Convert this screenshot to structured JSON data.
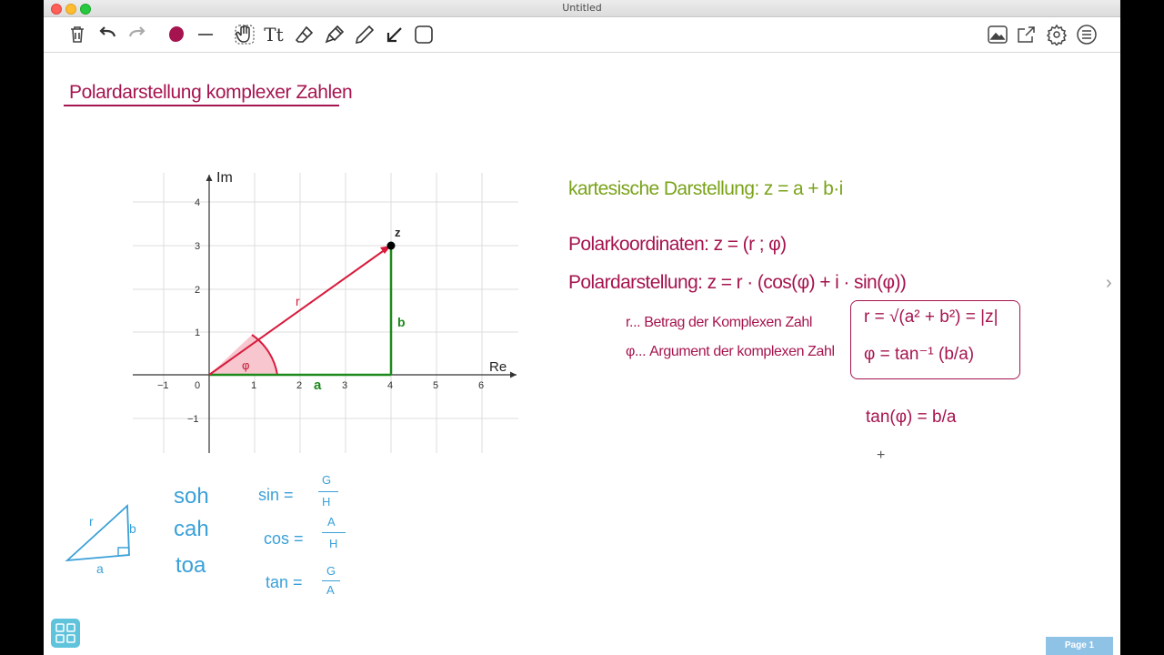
{
  "window": {
    "title": "Untitled"
  },
  "toolbar": {
    "tools": [
      "trash-icon",
      "undo-icon",
      "redo-icon",
      "color-swatch-icon",
      "line-width-icon",
      "hand-select-icon",
      "text-tool-icon",
      "eraser-icon",
      "highlighter-icon",
      "pen-icon",
      "arrow-icon",
      "shape-icon"
    ],
    "text_tool_label": "Tt",
    "right_tools": [
      "image-icon",
      "share-icon",
      "settings-icon",
      "menu-icon"
    ],
    "pen_color": "#a6144f"
  },
  "heading": "Polardarstellung komplexer Zahlen",
  "graph": {
    "x_axis_label": "Re",
    "y_axis_label": "Im",
    "x_ticks": [
      "−1",
      "0",
      "1",
      "2",
      "3",
      "4",
      "5",
      "6"
    ],
    "y_ticks": [
      "4",
      "3",
      "2",
      "1",
      "−1"
    ],
    "point_label": "z",
    "hyp_label": "r",
    "adj_label": "a",
    "opp_label": "b",
    "angle_label": "φ"
  },
  "notes": {
    "cartesian": "kartesische Darstellung: z = a + b·i",
    "polar_coords": "Polarkoordinaten: z = (r ; φ)",
    "polar_form": "Polardarstellung: z = r · (cos(φ) + i · sin(φ))",
    "r_desc": "r... Betrag der Komplexen Zahl",
    "phi_desc": "φ... Argument der komplexen Zahl",
    "r_formula": "r = √(a² + b²) = |z|",
    "phi_formula": "φ = tan⁻¹ (b/a)",
    "tan_formula": "tan(φ) = b/a"
  },
  "sketch": {
    "soh": "soh",
    "cah": "cah",
    "toa": "toa",
    "sin_lhs": "sin =",
    "sin_num": "G",
    "sin_den": "H",
    "cos_lhs": "cos =",
    "cos_num": "A",
    "cos_den": "H",
    "tan_lhs": "tan =",
    "tan_num": "G",
    "tan_den": "A",
    "tri_hyp": "r",
    "tri_opp": "b",
    "tri_adj": "a"
  },
  "footer": {
    "page_label": "Page 1"
  },
  "colors": {
    "magenta": "#a6144f",
    "green": "#7aa31a",
    "blue": "#3aa0d8",
    "red": "#d81b3c",
    "graph_green": "#1d8a1d"
  }
}
